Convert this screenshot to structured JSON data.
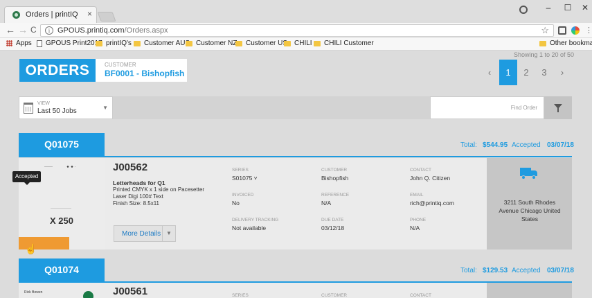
{
  "browser": {
    "tab_title": "Orders | printIQ",
    "close_glyph": "×",
    "url_host": "GPOUS.printiq.com",
    "url_path": "/Orders.aspx",
    "window_controls": {
      "minimize": "–",
      "maximize": "☐",
      "close": "✕"
    },
    "nav": {
      "back": "←",
      "forward": "→",
      "reload": "C"
    },
    "bookmarks": [
      {
        "label": "Apps",
        "icon": "apps-grid-icon"
      },
      {
        "label": "GPOUS Print2017",
        "icon": "page-icon"
      },
      {
        "label": "printIQ's",
        "icon": "folder-icon"
      },
      {
        "label": "Customer AUS",
        "icon": "folder-icon"
      },
      {
        "label": "Customer NZ",
        "icon": "folder-icon"
      },
      {
        "label": "Customer US",
        "icon": "folder-icon"
      },
      {
        "label": "CHILI",
        "icon": "folder-icon"
      },
      {
        "label": "CHILI Customer",
        "icon": "folder-icon"
      }
    ],
    "other_bookmarks": "Other bookmarks"
  },
  "header": {
    "showing": "Showing 1 to 20 of 50",
    "title": "ORDERS",
    "customer_label": "CUSTOMER",
    "customer_value": "BF0001 - Bishopfish",
    "pagination": {
      "prev": "‹",
      "pages": [
        "1",
        "2",
        "3"
      ],
      "active": "1",
      "next": "›"
    }
  },
  "filters": {
    "view_label": "VIEW",
    "view_value": "Last 50 Jobs",
    "find_placeholder": "Find Order"
  },
  "orders": [
    {
      "number": "Q01075",
      "total_label": "Total:",
      "total": "$544.95",
      "status": "Accepted",
      "date": "03/07/18",
      "job": {
        "number": "J00562",
        "title": "Letterheads for Q1",
        "desc_lines": [
          "Printed CMYK x 1 side on Pacesetter",
          "Laser Digi 100# Text",
          "Finish Size: 8.5x11"
        ],
        "qty": "X 250",
        "status_tooltip": "Accepted",
        "more_details": "More Details",
        "series_label": "SERIES",
        "series": "S01075 ˅",
        "invoiced_label": "INVOICED",
        "invoiced": "No",
        "tracking_label": "DELIVERY TRACKING",
        "tracking": "Not available",
        "customer_label": "CUSTOMER",
        "customer": "Bishopfish",
        "reference_label": "REFERENCE",
        "reference": "N/A",
        "due_label": "DUE DATE",
        "due": "03/12/18",
        "contact_label": "CONTACT",
        "contact": "John Q. Citizen",
        "email_label": "EMAIL",
        "email": "rich@printiq.com",
        "phone_label": "PHONE",
        "phone": "N/A",
        "address": "3211 South Rhodes Avenue Chicago United States"
      }
    },
    {
      "number": "Q01074",
      "total_label": "Total:",
      "total": "$129.53",
      "status": "Accepted",
      "date": "03/07/18",
      "job": {
        "number": "J00561",
        "thumb_text": "Rick Bowen",
        "series_label": "SERIES",
        "customer_label": "CUSTOMER",
        "contact_label": "CONTACT"
      }
    }
  ],
  "colors": {
    "accent": "#1e9be0",
    "status_orange": "#ef9a32",
    "page_bg": "#dcdcdc"
  }
}
